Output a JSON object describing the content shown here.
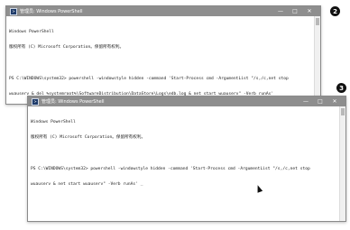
{
  "window1": {
    "title": "管理员: Windows PowerShell",
    "controls": [
      "—",
      "□",
      "✕"
    ],
    "lines": [
      "Windows PowerShell",
      "版权所有 (C) Microsoft Corporation。保留所有权利。",
      "",
      "PS C:\\WINDOWS\\system32> powershell -windowstyle hidden -command 'Start-Process cmd -ArgumentList \"/s,/c,net stop",
      "wuauserv & del %systemroot%\\SoftwareDistribution\\DataStore\\Logs\\edb.log & net start wuauserv\" -Verb runAs'"
    ],
    "badge": "2"
  },
  "window2": {
    "title": "管理员: Windows PowerShell",
    "controls": [
      "—",
      "□",
      "✕"
    ],
    "lines": [
      "Windows PowerShell",
      "版权所有 (C) Microsoft Corporation。保留所有权利。",
      "",
      "PS C:\\WINDOWS\\system32> powershell -windowstyle hidden -command 'Start-Process cmd -ArgumentList \"/s,/c,net stop",
      "wuauserv & net start wuauserv\" -Verb runAs' _"
    ],
    "badge": "3"
  }
}
